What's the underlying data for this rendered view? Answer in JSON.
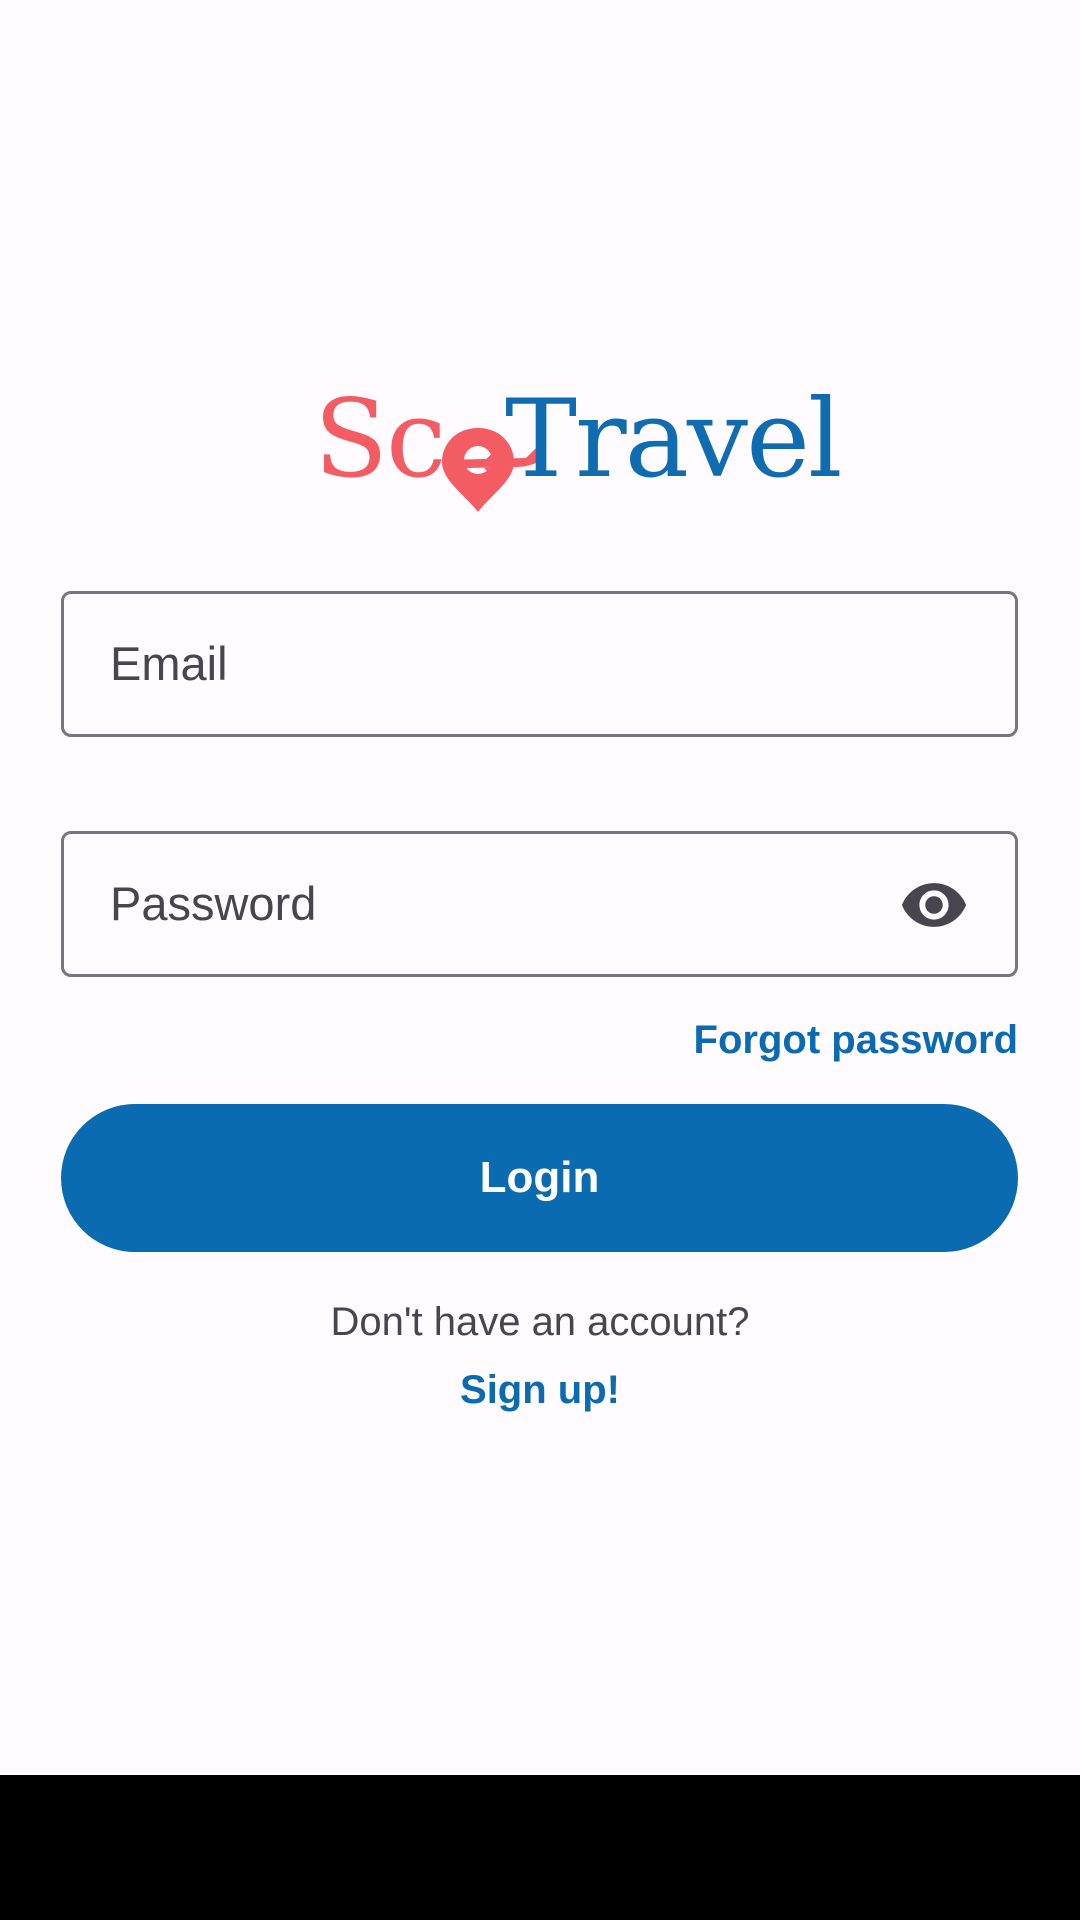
{
  "app": {
    "logo_text_left": "Sc",
    "logo_text_right": "Travel"
  },
  "form": {
    "email_placeholder": "Email",
    "email_value": "",
    "password_placeholder": "Password",
    "password_value": "",
    "toggle_visibility_icon": "eye-icon",
    "forgot_password_label": "Forgot password",
    "login_label": "Login"
  },
  "footer": {
    "no_account_text": "Don't have an account?",
    "signup_label": "Sign up!"
  },
  "colors": {
    "primary": "#0b6bb1",
    "logo_coral": "#f45c64",
    "logo_blue": "#0f6cb0",
    "outline": "#79747e",
    "on_surface_variant": "#49454f",
    "background": "#fffbfe"
  }
}
